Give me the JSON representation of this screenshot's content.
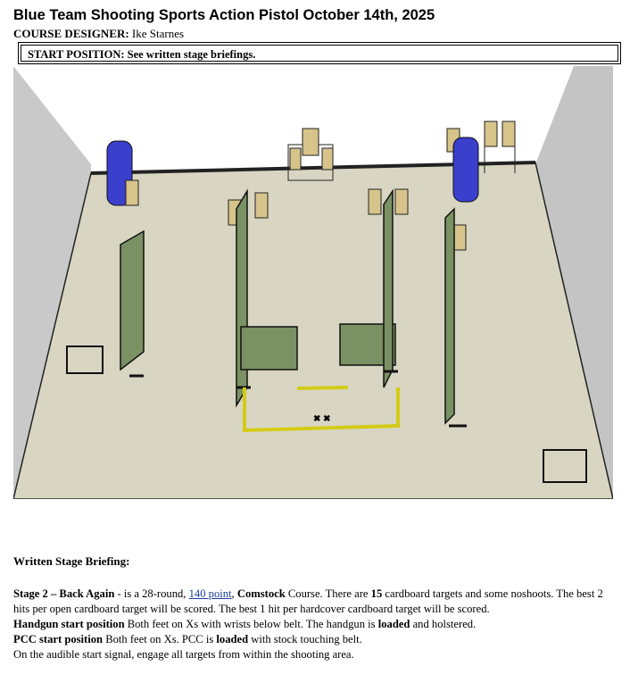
{
  "header": {
    "title": "Blue Team Shooting Sports Action Pistol October 14th, 2025",
    "designer_label": "COURSE DESIGNER:",
    "designer_name": " Ike Starnes",
    "start_position": "START POSITION: See written stage briefings."
  },
  "diagram": {
    "icon": "stage-layout-3d-diagram",
    "colors": {
      "floor": "#d8d6c3",
      "walls": "#c8c8c8",
      "barricade": "#7a9163",
      "barrel": "#3a3fcc",
      "fault_line": "#f3ea2b",
      "target": "#d6c48b"
    }
  },
  "briefing": {
    "heading": "Written Stage Briefing:",
    "stage_name": "Stage 2 – Back Again",
    "text1": " - is a 28-round, ",
    "points": "140 point",
    "text2": ", ",
    "scoring": "Comstock",
    "text3": " Course. There are ",
    "target_count": "15",
    "text4": " cardboard targets and some noshoots. The best 2 hits per open cardboard target will be scored. The best 1 hit per hardcover cardboard target will be scored.",
    "handgun_label": "Handgun start position",
    "handgun_text1": " Both feet on Xs with wrists below belt. The handgun is ",
    "handgun_loaded": "loaded",
    "handgun_text2": " and holstered.",
    "pcc_label": "PCC start position",
    "pcc_text1": " Both feet on Xs. PCC is ",
    "pcc_loaded": "loaded",
    "pcc_text2": " with stock touching belt.",
    "signal_text": "On the audible start signal, engage all targets from within the shooting area."
  }
}
